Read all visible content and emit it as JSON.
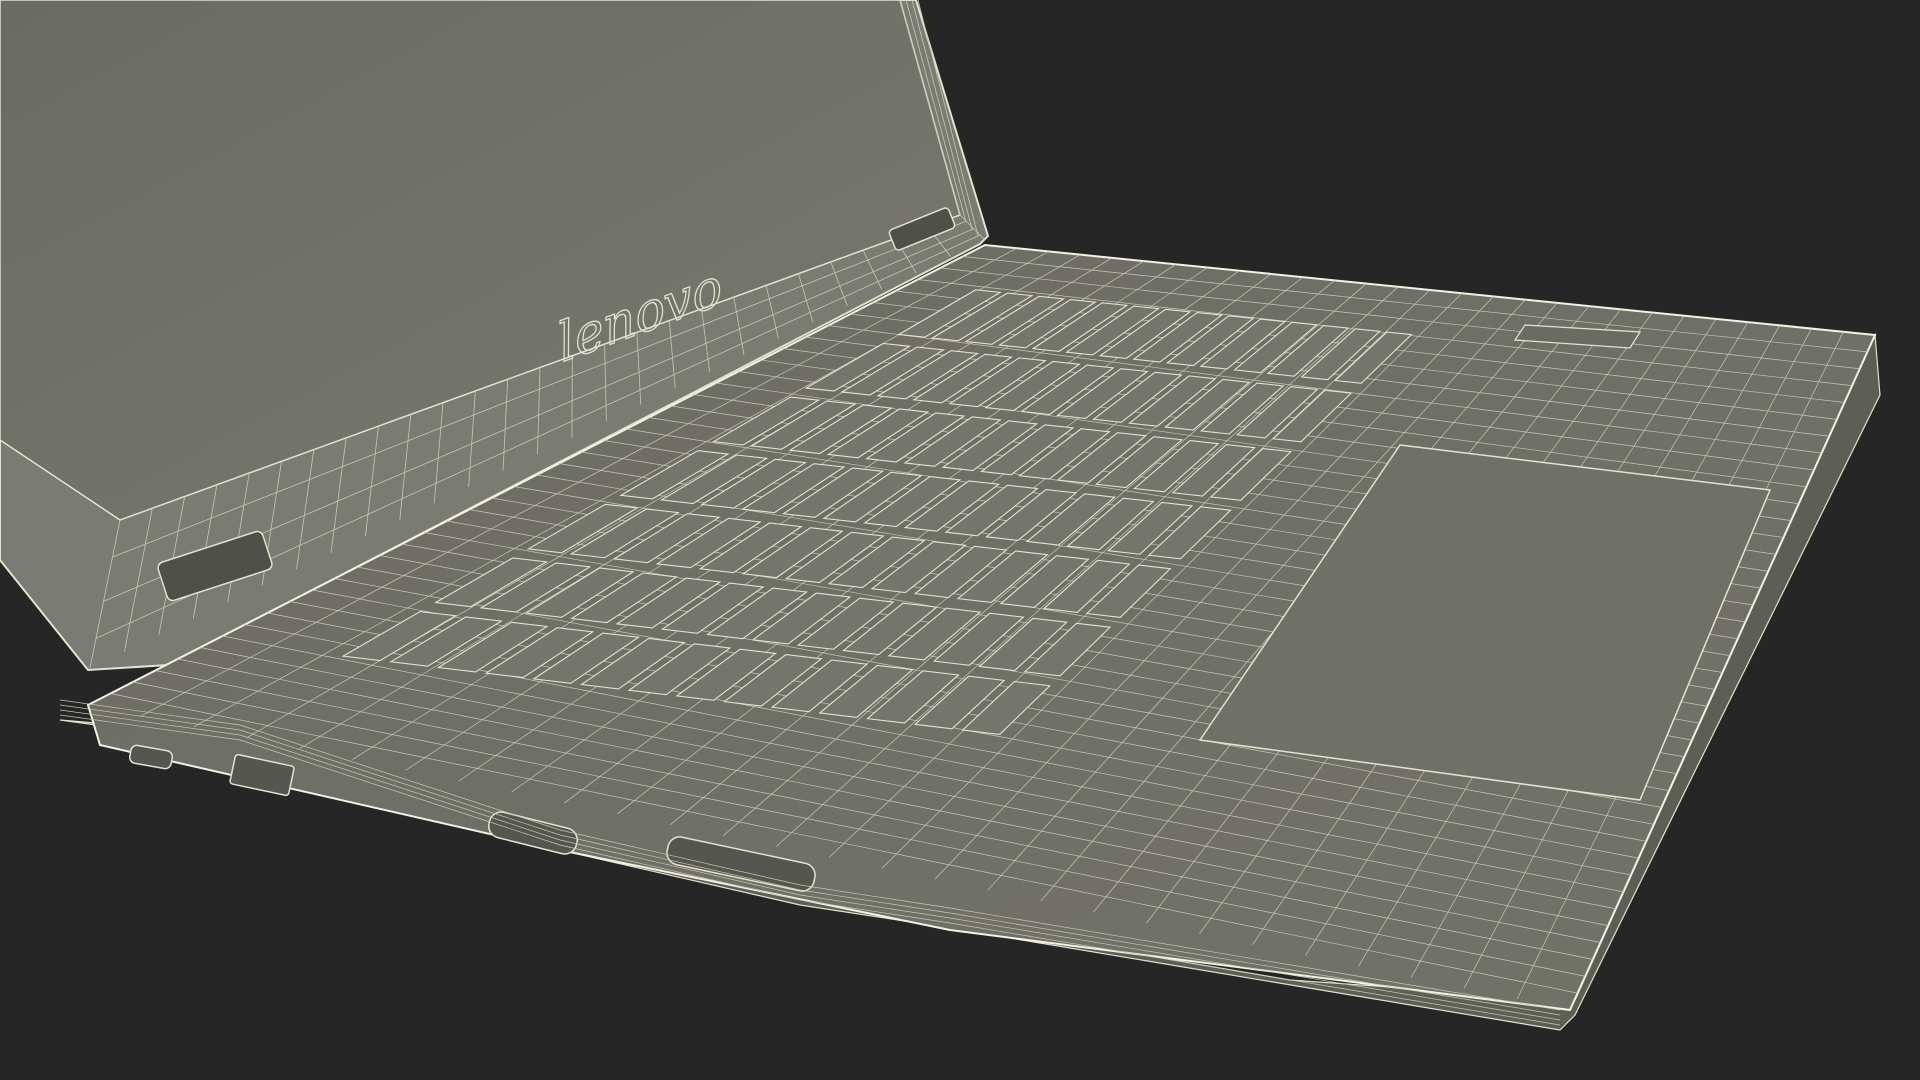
{
  "render": {
    "background_color": "#262626",
    "surface_color": "#6e6f66",
    "surface_dark": "#5c5d55",
    "wire_color": "#e4e2cf",
    "wire_dim": "#c9c7b2",
    "edge_color": "#f3f1e2"
  },
  "laptop": {
    "logo_text": "lenovo",
    "keyboard_rows": 7,
    "keyboard_cols": 14
  }
}
